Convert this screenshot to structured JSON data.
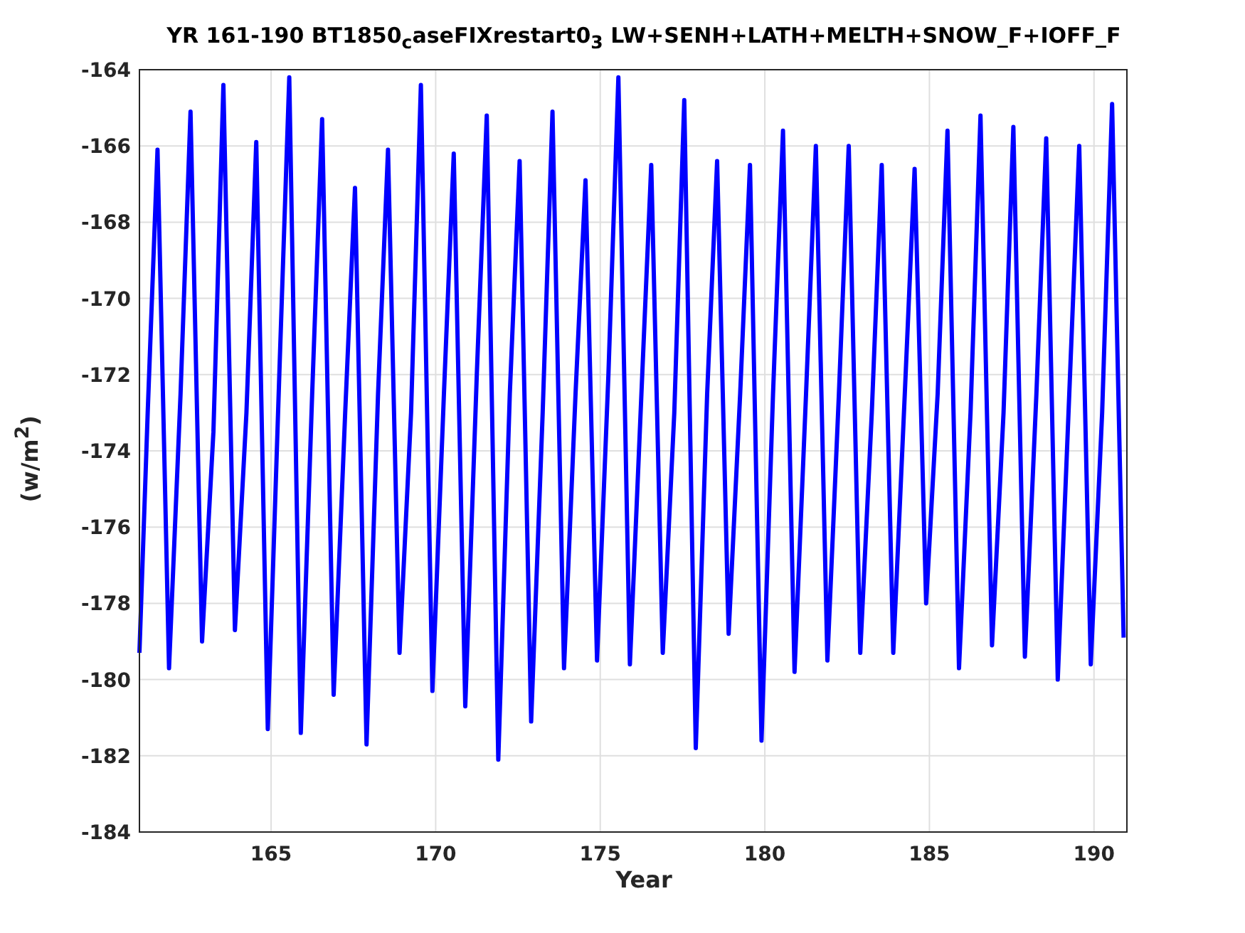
{
  "figure": {
    "chart_data": {
      "type": "line",
      "title": "YR 161-190 BT1850$_{c}$aseFIXrestart0$_{3}$ LW+SENH+LATH+MELTH+SNOW_F+IOFF_F",
      "xlabel": "Year",
      "ylabel": "(w/m$^{2}$)",
      "grid": true,
      "xlim": [
        161,
        191
      ],
      "ylim": [
        -184,
        -164
      ],
      "xticks": [
        165,
        170,
        175,
        180,
        185,
        190
      ],
      "yticks": [
        -184,
        -182,
        -180,
        -178,
        -176,
        -174,
        -172,
        -170,
        -168,
        -166,
        -164
      ],
      "x": [
        161,
        161.25,
        161.55,
        161.9,
        162.25,
        162.55,
        162.9,
        163.25,
        163.55,
        163.9,
        164.25,
        164.55,
        164.9,
        165.25,
        165.55,
        165.9,
        166.25,
        166.55,
        166.9,
        167.25,
        167.55,
        167.9,
        168.25,
        168.55,
        168.9,
        169.25,
        169.55,
        169.9,
        170.25,
        170.55,
        170.9,
        171.25,
        171.55,
        171.9,
        172.25,
        172.55,
        172.9,
        173.25,
        173.55,
        173.9,
        174.25,
        174.55,
        174.9,
        175.25,
        175.55,
        175.9,
        176.25,
        176.55,
        176.9,
        177.25,
        177.55,
        177.9,
        178.25,
        178.55,
        178.9,
        179.25,
        179.55,
        179.9,
        180.25,
        180.55,
        180.9,
        181.25,
        181.55,
        181.9,
        182.25,
        182.55,
        182.9,
        183.25,
        183.55,
        183.9,
        184.25,
        184.55,
        184.9,
        185.25,
        185.55,
        185.9,
        186.25,
        186.55,
        186.9,
        187.25,
        187.55,
        187.9,
        188.25,
        188.55,
        188.9,
        189.25,
        189.55,
        189.9,
        190.25,
        190.55,
        190.9
      ],
      "series": [
        {
          "color": "#0000ff",
          "values": [
            -179.3,
            -173,
            -166.1,
            -179.7,
            -172.5,
            -165.1,
            -179.0,
            -173.5,
            -164.4,
            -178.7,
            -173,
            -165.9,
            -181.3,
            -172,
            -164.2,
            -181.4,
            -172.5,
            -165.3,
            -180.4,
            -173,
            -167.1,
            -181.7,
            -172.5,
            -166.1,
            -179.3,
            -173,
            -164.4,
            -180.3,
            -172.5,
            -166.2,
            -180.7,
            -172,
            -165.2,
            -182.1,
            -172.5,
            -166.4,
            -181.1,
            -173,
            -165.1,
            -179.7,
            -172.5,
            -166.9,
            -179.5,
            -172,
            -164.2,
            -179.6,
            -172.5,
            -166.5,
            -179.3,
            -173,
            -164.8,
            -181.8,
            -172.5,
            -166.4,
            -178.8,
            -172.5,
            -166.5,
            -181.6,
            -172.5,
            -165.6,
            -179.8,
            -172.5,
            -166.0,
            -179.5,
            -172.5,
            -166.0,
            -179.3,
            -173,
            -166.5,
            -179.3,
            -172.5,
            -166.6,
            -178.0,
            -172.5,
            -165.6,
            -179.7,
            -173,
            -165.2,
            -179.1,
            -173,
            -165.5,
            -179.4,
            -172.5,
            -165.8,
            -180.0,
            -172.5,
            -166.0,
            -179.6,
            -173,
            -164.9,
            -178.9
          ]
        }
      ]
    }
  }
}
